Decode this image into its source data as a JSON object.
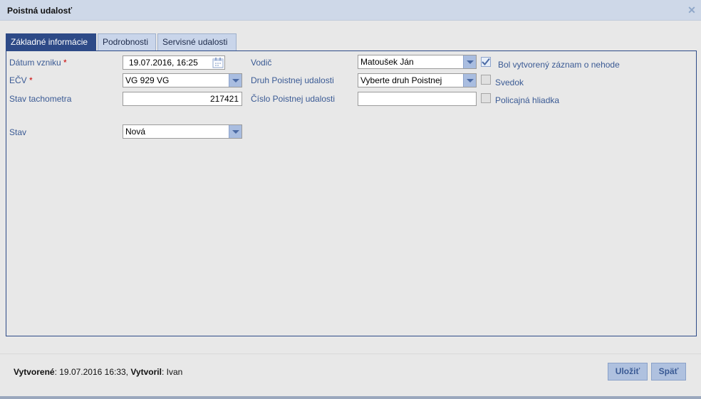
{
  "window": {
    "title": "Poistná udalosť"
  },
  "tabs": [
    {
      "label": "Základné informácie",
      "active": true
    },
    {
      "label": "Podrobnosti",
      "active": false
    },
    {
      "label": "Servisné udalosti",
      "active": false
    }
  ],
  "form": {
    "datum_vzniku": {
      "label": "Dátum vzniku",
      "required": "*",
      "value": "19.07.2016, 16:25"
    },
    "ecv": {
      "label": "EČV",
      "required": "*",
      "value": "VG 929 VG"
    },
    "stav_tachometra": {
      "label": "Stav tachometra",
      "value": "217421"
    },
    "stav": {
      "label": "Stav",
      "value": "Nová"
    },
    "vodic": {
      "label": "Vodič",
      "value": "Matoušek Ján"
    },
    "druh_poistnej_udalosti": {
      "label": "Druh Poistnej udalosti",
      "value": "Vyberte druh Poistnej"
    },
    "cislo_poistnej_udalosti": {
      "label": "Číslo Poistnej udalosti",
      "value": ""
    },
    "checkboxes": [
      {
        "label": "Bol vytvorený záznam o nehode",
        "checked": true
      },
      {
        "label": "Svedok",
        "checked": false
      },
      {
        "label": "Policajná hliadka",
        "checked": false
      }
    ]
  },
  "footer": {
    "created_label": "Vytvorené",
    "created_value": ": 19.07.2016 16:33, ",
    "created_by_label": "Vytvoril",
    "created_by_value": ": Ivan",
    "save_label": "Uložiť",
    "back_label": "Späť"
  },
  "colors": {
    "accent": "#2d4a87",
    "label": "#3a5a94",
    "titlebar": "#ced8e8"
  }
}
